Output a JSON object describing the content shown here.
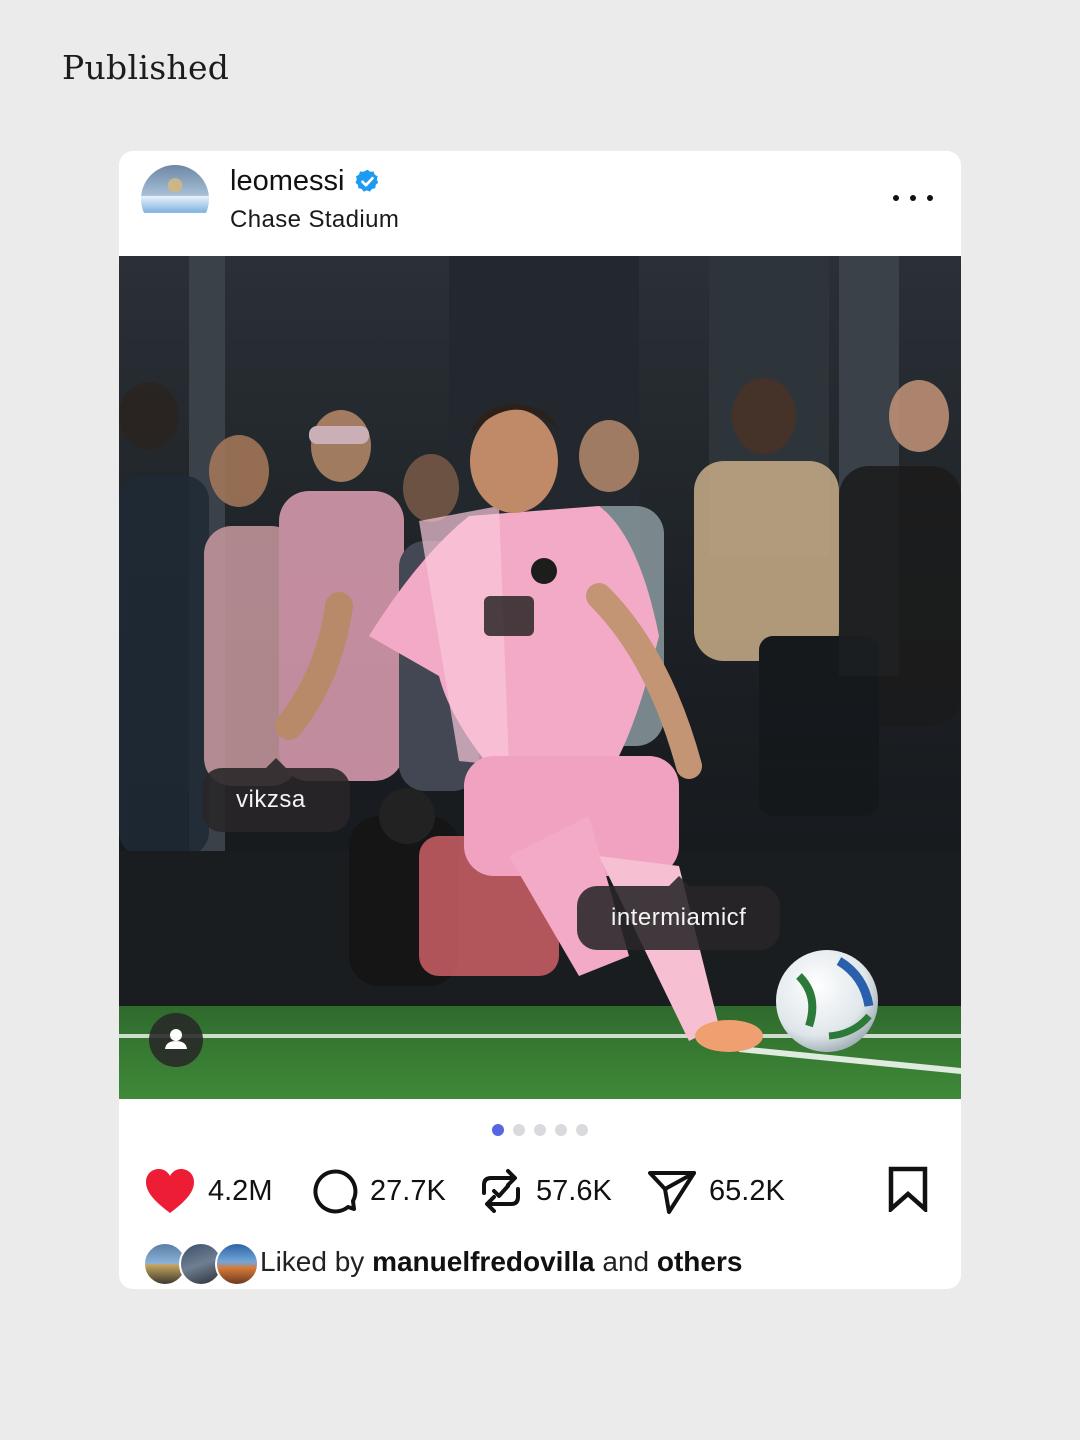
{
  "page": {
    "label": "Published"
  },
  "post": {
    "username": "leomessi",
    "location": "Chase Stadium",
    "tags": {
      "tag1": "vikzsa",
      "tag2": "intermiamicf"
    },
    "carousel": {
      "count": 5,
      "active_index": 0
    },
    "stats": {
      "likes": "4.2M",
      "comments": "27.7K",
      "reposts": "57.6K",
      "shares": "65.2K"
    },
    "liked_by": {
      "prefix": "Liked by",
      "user": "manuelfredovilla",
      "joiner": "and",
      "others": "others"
    }
  },
  "icons": {
    "verified": "verified-badge-icon",
    "more": "more-options-icon",
    "people": "tagged-people-icon",
    "like": "heart-icon",
    "comment": "comment-icon",
    "repost": "repost-icon",
    "share": "send-icon",
    "bookmark": "bookmark-icon"
  },
  "colors": {
    "accent_dot": "#5865e0",
    "heart": "#ee1d36",
    "verified": "#1d9bf0",
    "jersey_pink": "#f2aac6"
  }
}
